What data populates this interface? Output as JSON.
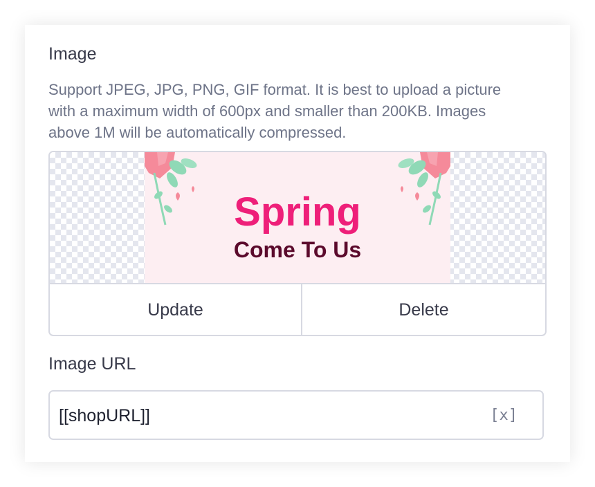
{
  "image_section": {
    "title": "Image",
    "help": "Support JPEG, JPG, PNG, GIF format. It is best to upload a picture with a maximum width of 600px and smaller than 200KB. Images above 1M will be automatically compressed.",
    "banner": {
      "headline": "Spring",
      "subline": "Come To Us",
      "colors": {
        "background": "#fdeef2",
        "headline": "#ee1f79",
        "subline": "#5b0a2c",
        "leaf": "#8fd9b6",
        "petal": "#f58a9a"
      }
    },
    "update_label": "Update",
    "delete_label": "Delete"
  },
  "url_section": {
    "label": "Image URL",
    "value": "[[shopURL]]",
    "clear_label": "[x]"
  }
}
